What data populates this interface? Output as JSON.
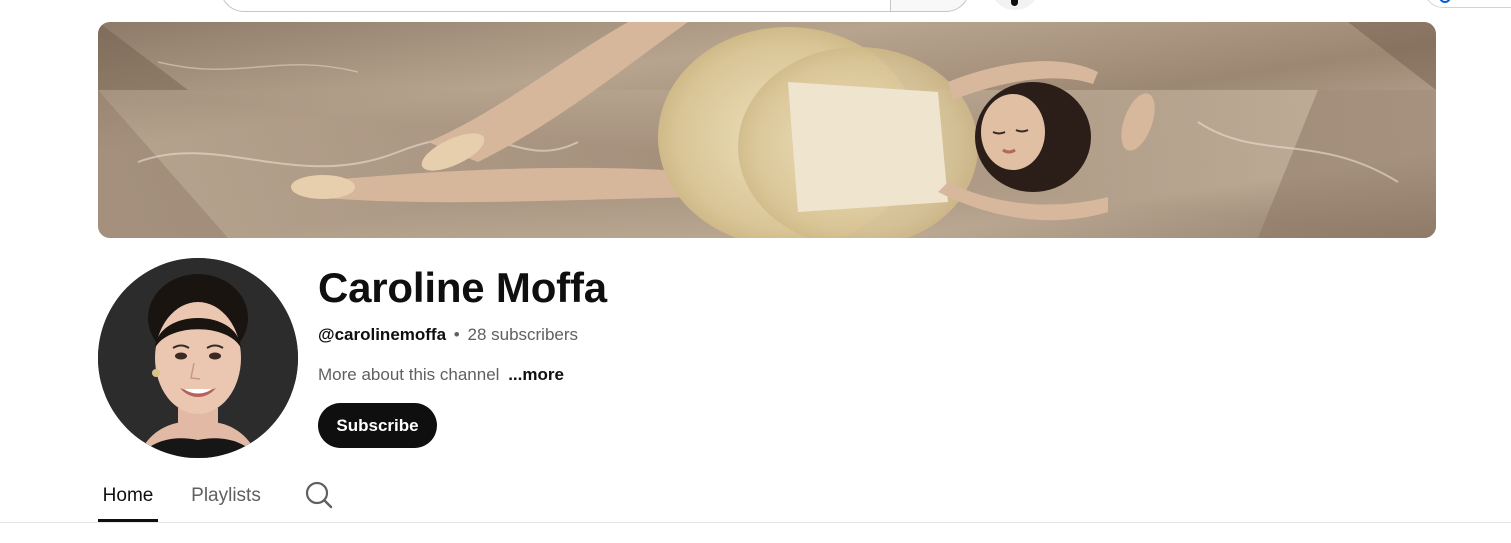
{
  "channel": {
    "name": "Caroline Moffa",
    "handle": "@carolinemoffa",
    "separator": "•",
    "subscribers": "28 subscribers",
    "description": "More about this channel",
    "more_label": "...more",
    "subscribe_label": "Subscribe"
  },
  "tabs": [
    {
      "label": "Home",
      "active": true
    },
    {
      "label": "Playlists",
      "active": false
    }
  ],
  "icons": {
    "tab_search": "search-icon",
    "voice": "mic-icon",
    "account": "account-icon"
  },
  "colors": {
    "subscribe_bg": "#0f0f0f",
    "text_primary": "#0f0f0f",
    "text_secondary": "#606060",
    "divider": "#e5e5e5"
  }
}
